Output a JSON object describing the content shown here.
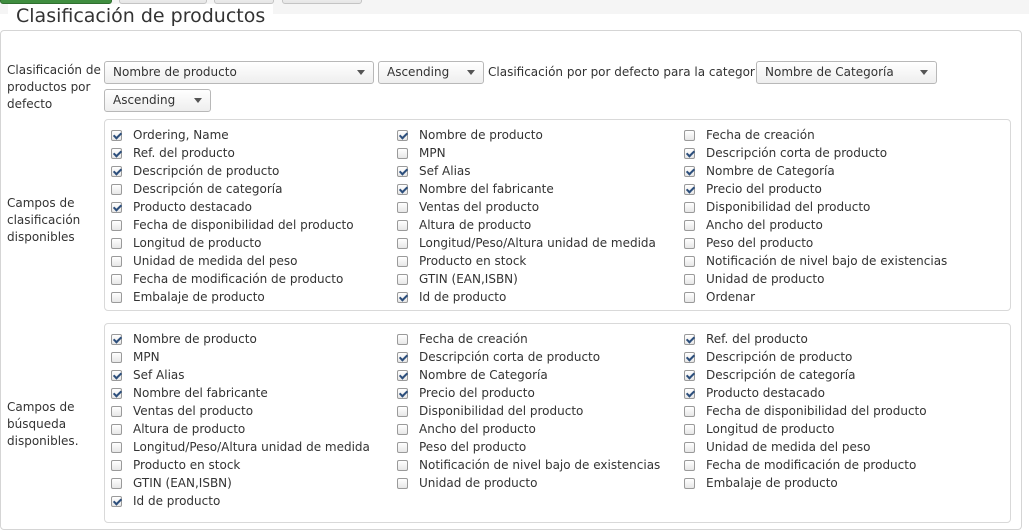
{
  "legend": "Clasificación de productos",
  "default_sort": {
    "label": "Clasificación de productos por defecto",
    "field_select": "Nombre de producto",
    "order_select": "Ascending",
    "category_label": "Clasificación por por defecto para la categoría",
    "category_select": "Nombre de Categoría",
    "category_order_select": "Ascending"
  },
  "sort_fields": {
    "label": "Campos de clasificación disponibles",
    "columns": [
      [
        {
          "label": "Ordering, Name",
          "checked": true
        },
        {
          "label": "Ref. del producto",
          "checked": true
        },
        {
          "label": "Descripción de producto",
          "checked": true
        },
        {
          "label": "Descripción de categoría",
          "checked": false
        },
        {
          "label": "Producto destacado",
          "checked": true
        },
        {
          "label": "Fecha de disponibilidad del producto",
          "checked": false
        },
        {
          "label": "Longitud de producto",
          "checked": false
        },
        {
          "label": "Unidad de medida del peso",
          "checked": false
        },
        {
          "label": "Fecha de modificación de producto",
          "checked": false
        },
        {
          "label": "Embalaje de producto",
          "checked": false
        }
      ],
      [
        {
          "label": "Nombre de producto",
          "checked": true
        },
        {
          "label": "MPN",
          "checked": false
        },
        {
          "label": "Sef Alias",
          "checked": true
        },
        {
          "label": "Nombre del fabricante",
          "checked": true
        },
        {
          "label": "Ventas del producto",
          "checked": false
        },
        {
          "label": "Altura de producto",
          "checked": false
        },
        {
          "label": "Longitud/Peso/Altura unidad de medida",
          "checked": false
        },
        {
          "label": "Producto en stock",
          "checked": false
        },
        {
          "label": "GTIN (EAN,ISBN)",
          "checked": false
        },
        {
          "label": "Id de producto",
          "checked": true
        }
      ],
      [
        {
          "label": "Fecha de creación",
          "checked": false
        },
        {
          "label": "Descripción corta de producto",
          "checked": true
        },
        {
          "label": "Nombre de Categoría",
          "checked": true
        },
        {
          "label": "Precio del producto",
          "checked": true
        },
        {
          "label": "Disponibilidad del producto",
          "checked": false
        },
        {
          "label": "Ancho del producto",
          "checked": false
        },
        {
          "label": "Peso del producto",
          "checked": false
        },
        {
          "label": "Notificación de nivel bajo de existencias",
          "checked": false
        },
        {
          "label": "Unidad de producto",
          "checked": false
        },
        {
          "label": "Ordenar",
          "checked": false
        }
      ]
    ]
  },
  "search_fields": {
    "label": "Campos de búsqueda disponibles.",
    "columns": [
      [
        {
          "label": "Nombre de producto",
          "checked": true
        },
        {
          "label": "MPN",
          "checked": false
        },
        {
          "label": "Sef Alias",
          "checked": true
        },
        {
          "label": "Nombre del fabricante",
          "checked": true
        },
        {
          "label": "Ventas del producto",
          "checked": false
        },
        {
          "label": "Altura de producto",
          "checked": false
        },
        {
          "label": "Longitud/Peso/Altura unidad de medida",
          "checked": false
        },
        {
          "label": "Producto en stock",
          "checked": false
        },
        {
          "label": "GTIN (EAN,ISBN)",
          "checked": false
        },
        {
          "label": "Id de producto",
          "checked": true
        }
      ],
      [
        {
          "label": "Fecha de creación",
          "checked": false
        },
        {
          "label": "Descripción corta de producto",
          "checked": true
        },
        {
          "label": "Nombre de Categoría",
          "checked": true
        },
        {
          "label": "Precio del producto",
          "checked": true
        },
        {
          "label": "Disponibilidad del producto",
          "checked": false
        },
        {
          "label": "Ancho del producto",
          "checked": false
        },
        {
          "label": "Peso del producto",
          "checked": false
        },
        {
          "label": "Notificación de nivel bajo de existencias",
          "checked": false
        },
        {
          "label": "Unidad de producto",
          "checked": false
        }
      ],
      [
        {
          "label": "Ref. del producto",
          "checked": true
        },
        {
          "label": "Descripción de producto",
          "checked": true
        },
        {
          "label": "Descripción de categoría",
          "checked": true
        },
        {
          "label": "Producto destacado",
          "checked": true
        },
        {
          "label": "Fecha de disponibilidad del producto",
          "checked": false
        },
        {
          "label": "Longitud de producto",
          "checked": false
        },
        {
          "label": "Unidad de medida del peso",
          "checked": false
        },
        {
          "label": "Fecha de modificación de producto",
          "checked": false
        },
        {
          "label": "Embalaje de producto",
          "checked": false
        }
      ]
    ]
  }
}
